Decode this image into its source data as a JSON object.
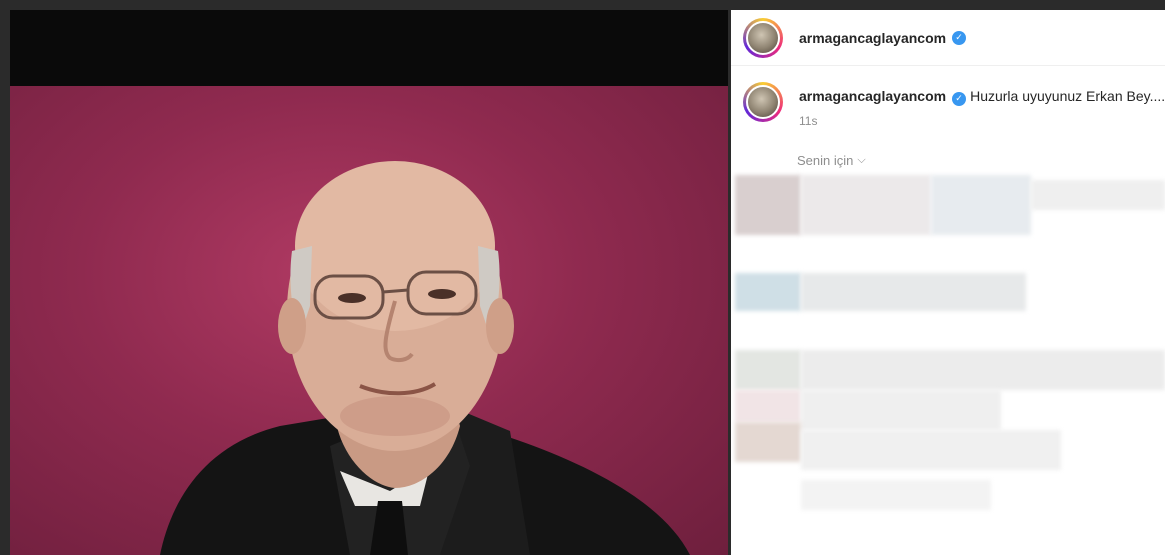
{
  "post": {
    "header_username": "armagancaglayancom",
    "caption_username": "armagancaglayancom",
    "caption": "Huzurla uyuyunuz Erkan Bey....",
    "time": "11s"
  },
  "sidebar": {
    "for_you_label": "Senin için"
  },
  "icons": {
    "verified": "verified-badge-icon",
    "chevron": "chevron-down-icon"
  },
  "colors": {
    "photo_background": "#9b3058",
    "verified_blue": "#3897f0",
    "username_text": "#262626",
    "muted_text": "#8e8e8e"
  }
}
